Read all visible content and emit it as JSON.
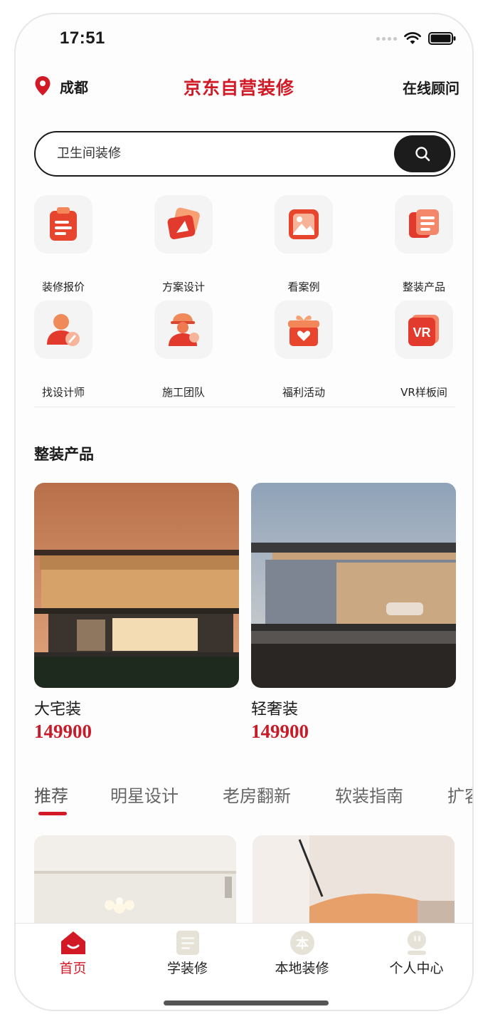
{
  "status": {
    "time": "17:51"
  },
  "header": {
    "city": "成都",
    "brand": "京东自营装修",
    "consult": "在线顾问"
  },
  "search": {
    "value": "卫生间装修"
  },
  "quick_menu": [
    {
      "label": "装修报价",
      "icon": "quote-clipboard-icon"
    },
    {
      "label": "方案设计",
      "icon": "design-plan-icon"
    },
    {
      "label": "看案例",
      "icon": "case-gallery-icon"
    },
    {
      "label": "整装产品",
      "icon": "package-product-icon"
    },
    {
      "label": "找设计师",
      "icon": "designer-person-icon"
    },
    {
      "label": "施工团队",
      "icon": "construction-worker-icon"
    },
    {
      "label": "福利活动",
      "icon": "gift-box-icon"
    },
    {
      "label": "VR样板间",
      "icon": "vr-showroom-icon",
      "badge": "VR"
    }
  ],
  "section": {
    "title": "整装产品"
  },
  "products": [
    {
      "name": "大宅装",
      "price": "149900"
    },
    {
      "name": "轻奢装",
      "price": "149900"
    }
  ],
  "tabs": [
    "推荐",
    "明星设计",
    "老房翻新",
    "软装指南",
    "扩容"
  ],
  "active_tab": "推荐",
  "bottom_nav": [
    {
      "label": "首页",
      "icon": "home-icon",
      "active": true
    },
    {
      "label": "学装修",
      "icon": "learn-doc-icon",
      "active": false
    },
    {
      "label": "本地装修",
      "icon": "local-ben-icon",
      "badge": "本",
      "active": false
    },
    {
      "label": "个人中心",
      "icon": "profile-icon",
      "active": false
    }
  ],
  "colors": {
    "brand_red": "#d11a26",
    "price_red": "#c81b28",
    "search_button": "#1c1c1c"
  }
}
